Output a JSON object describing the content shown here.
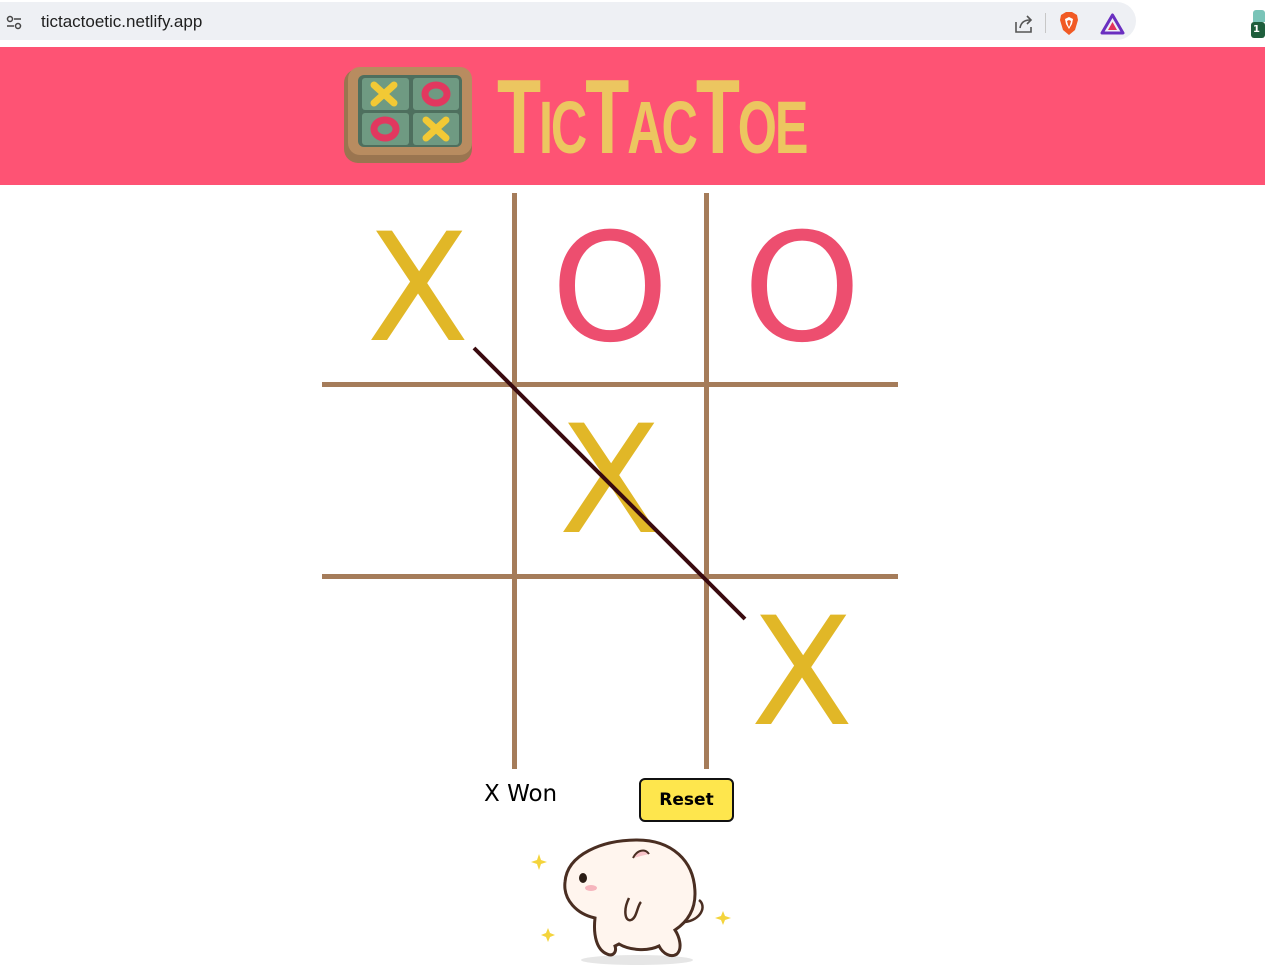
{
  "browser": {
    "url": "tictactoetic.netlify.app",
    "extension_badge": "1",
    "icons": [
      "site-info-icon",
      "share-icon",
      "brave-shield-icon",
      "brave-rewards-icon",
      "extension-icon"
    ]
  },
  "header": {
    "title": "TicTacToe",
    "background_color": "#fe5374",
    "title_color": "#ecc660"
  },
  "game": {
    "cells": [
      "X",
      "O",
      "O",
      "",
      "X",
      "",
      "",
      "",
      "X"
    ],
    "x_color": "#e1b727",
    "o_color": "#ed4e6f",
    "grid_color": "#a57c5a",
    "winning_cells": [
      0,
      4,
      8
    ],
    "winner": "X",
    "status": "X Won",
    "reset_label": "Reset"
  }
}
